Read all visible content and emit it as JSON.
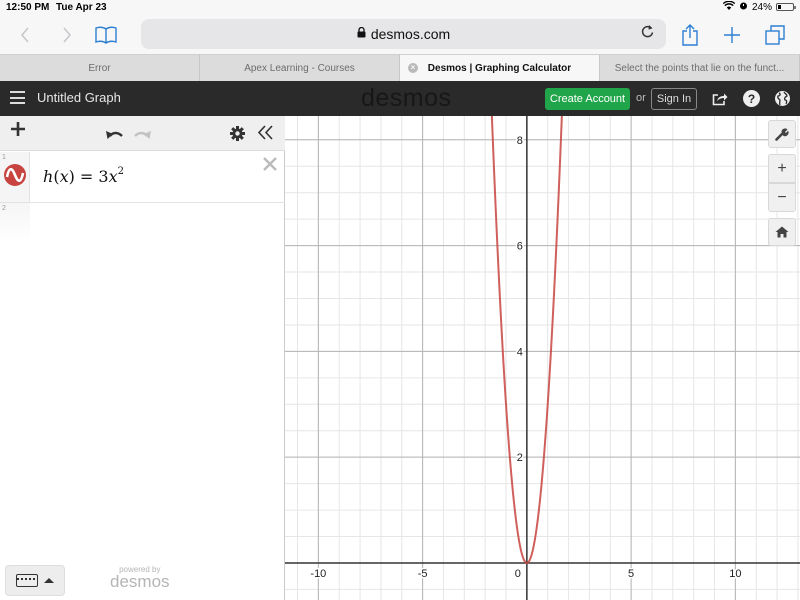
{
  "status_bar": {
    "time": "12:50 PM",
    "date": "Tue Apr 23",
    "battery_percent": "24%",
    "battery_level": 0.24
  },
  "browser": {
    "url": "desmos.com",
    "icons": {
      "back": "chevron-left-icon",
      "forward": "chevron-right-icon",
      "bookmarks": "book-icon",
      "lock": "lock-icon",
      "reload": "reload-icon",
      "share": "share-icon",
      "new_tab": "plus-icon",
      "tabs": "tabs-icon"
    },
    "tabs": [
      {
        "label": "Error",
        "active": false
      },
      {
        "label": "Apex Learning - Courses",
        "active": false
      },
      {
        "label": "Desmos | Graphing Calculator",
        "active": true
      },
      {
        "label": "Select the points that lie on the funct...",
        "active": false
      }
    ]
  },
  "desmos_header": {
    "graph_title": "Untitled Graph",
    "logo": "desmos",
    "create_account_label": "Create Account",
    "or_label": "or",
    "sign_in_label": "Sign In",
    "help_label": "?",
    "accent_color": "#21a54a"
  },
  "expression_panel": {
    "expressions": [
      {
        "index": "1",
        "color": "#c74440",
        "name": "h",
        "var": "x",
        "coefficient": "3",
        "exponent": "2"
      },
      {
        "index": "2"
      }
    ],
    "powered_by": "powered by",
    "powered_logo": "desmos"
  },
  "graph_controls": {
    "zoom_in": "+",
    "zoom_out": "−"
  },
  "chart_data": {
    "type": "line",
    "title": "",
    "xlabel": "",
    "ylabel": "",
    "function": "h(x) = 3x^2",
    "series": [
      {
        "name": "h(x) = 3x^2",
        "color": "#c74440",
        "coefficient": 3,
        "exponent": 2
      }
    ],
    "xlim": [
      -11.6,
      13.1
    ],
    "ylim": [
      -0.7,
      8.45
    ],
    "x_ticks": [
      -10,
      -5,
      0,
      5,
      10
    ],
    "x_tick_labels": [
      "-10",
      "-5",
      "0",
      "5",
      "10"
    ],
    "y_ticks": [
      2,
      4,
      6,
      8
    ],
    "y_tick_labels": [
      "2",
      "4",
      "6",
      "8"
    ],
    "x_minor_step": 1,
    "y_minor_step": 0.5,
    "grid": true
  }
}
